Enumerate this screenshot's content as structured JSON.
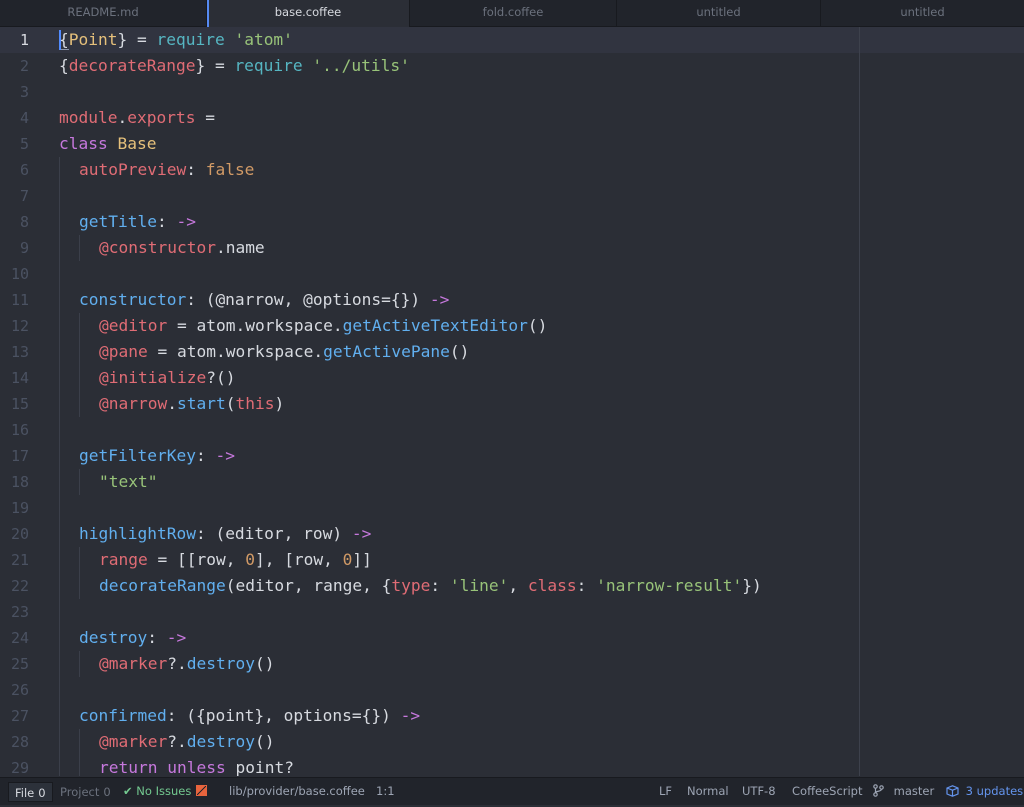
{
  "tabs": [
    {
      "label": "README.md",
      "active": false
    },
    {
      "label": "base.coffee",
      "active": true
    },
    {
      "label": "fold.coffee",
      "active": false
    },
    {
      "label": "untitled",
      "active": false
    },
    {
      "label": "untitled",
      "active": false
    }
  ],
  "editor": {
    "cursor_line": 1,
    "lines": [
      {
        "n": "1",
        "indent": 0,
        "tokens": [
          [
            "p",
            "{"
          ],
          [
            "c",
            "Point"
          ],
          [
            "p",
            "} = "
          ],
          [
            "r",
            "require"
          ],
          [
            "p",
            " "
          ],
          [
            "s",
            "'atom'"
          ]
        ]
      },
      {
        "n": "2",
        "indent": 0,
        "tokens": [
          [
            "p",
            "{"
          ],
          [
            "v",
            "decorateRange"
          ],
          [
            "p",
            "} = "
          ],
          [
            "r",
            "require"
          ],
          [
            "p",
            " "
          ],
          [
            "s",
            "'../utils'"
          ]
        ]
      },
      {
        "n": "3",
        "indent": 0,
        "tokens": []
      },
      {
        "n": "4",
        "indent": 0,
        "tokens": [
          [
            "v",
            "module"
          ],
          [
            "p",
            "."
          ],
          [
            "v",
            "exports"
          ],
          [
            "p",
            " ="
          ]
        ]
      },
      {
        "n": "5",
        "indent": 0,
        "tokens": [
          [
            "k",
            "class"
          ],
          [
            "p",
            " "
          ],
          [
            "c",
            "Base"
          ]
        ]
      },
      {
        "n": "6",
        "indent": 1,
        "tokens": [
          [
            "v",
            "autoPreview"
          ],
          [
            "p",
            ": "
          ],
          [
            "n",
            "false"
          ]
        ]
      },
      {
        "n": "7",
        "indent": 1,
        "tokens": []
      },
      {
        "n": "8",
        "indent": 1,
        "tokens": [
          [
            "f",
            "getTitle"
          ],
          [
            "p",
            ": "
          ],
          [
            "k",
            "->"
          ]
        ]
      },
      {
        "n": "9",
        "indent": 2,
        "tokens": [
          [
            "v",
            "@constructor"
          ],
          [
            "p",
            ".name"
          ]
        ]
      },
      {
        "n": "10",
        "indent": 1,
        "tokens": []
      },
      {
        "n": "11",
        "indent": 1,
        "tokens": [
          [
            "f",
            "constructor"
          ],
          [
            "p",
            ": (@narrow, @options={}) "
          ],
          [
            "k",
            "->"
          ]
        ]
      },
      {
        "n": "12",
        "indent": 2,
        "tokens": [
          [
            "v",
            "@editor"
          ],
          [
            "p",
            " = atom.workspace."
          ],
          [
            "f",
            "getActiveTextEditor"
          ],
          [
            "p",
            "()"
          ]
        ]
      },
      {
        "n": "13",
        "indent": 2,
        "tokens": [
          [
            "v",
            "@pane"
          ],
          [
            "p",
            " = atom.workspace."
          ],
          [
            "f",
            "getActivePane"
          ],
          [
            "p",
            "()"
          ]
        ]
      },
      {
        "n": "14",
        "indent": 2,
        "tokens": [
          [
            "v",
            "@initialize"
          ],
          [
            "p",
            "?()"
          ]
        ]
      },
      {
        "n": "15",
        "indent": 2,
        "tokens": [
          [
            "v",
            "@narrow"
          ],
          [
            "p",
            "."
          ],
          [
            "f",
            "start"
          ],
          [
            "p",
            "("
          ],
          [
            "v",
            "this"
          ],
          [
            "p",
            ")"
          ]
        ]
      },
      {
        "n": "16",
        "indent": 1,
        "tokens": []
      },
      {
        "n": "17",
        "indent": 1,
        "tokens": [
          [
            "f",
            "getFilterKey"
          ],
          [
            "p",
            ": "
          ],
          [
            "k",
            "->"
          ]
        ]
      },
      {
        "n": "18",
        "indent": 2,
        "tokens": [
          [
            "s",
            "\"text\""
          ]
        ]
      },
      {
        "n": "19",
        "indent": 1,
        "tokens": []
      },
      {
        "n": "20",
        "indent": 1,
        "tokens": [
          [
            "f",
            "highlightRow"
          ],
          [
            "p",
            ": (editor, row) "
          ],
          [
            "k",
            "->"
          ]
        ]
      },
      {
        "n": "21",
        "indent": 2,
        "tokens": [
          [
            "v",
            "range"
          ],
          [
            "p",
            " = [[row, "
          ],
          [
            "n",
            "0"
          ],
          [
            "p",
            "], [row, "
          ],
          [
            "n",
            "0"
          ],
          [
            "p",
            "]]"
          ]
        ]
      },
      {
        "n": "22",
        "indent": 2,
        "tokens": [
          [
            "f",
            "decorateRange"
          ],
          [
            "p",
            "(editor, range, {"
          ],
          [
            "v",
            "type"
          ],
          [
            "p",
            ": "
          ],
          [
            "s",
            "'line'"
          ],
          [
            "p",
            ", "
          ],
          [
            "v",
            "class"
          ],
          [
            "p",
            ": "
          ],
          [
            "s",
            "'narrow-result'"
          ],
          [
            "p",
            "})"
          ]
        ]
      },
      {
        "n": "23",
        "indent": 1,
        "tokens": []
      },
      {
        "n": "24",
        "indent": 1,
        "tokens": [
          [
            "f",
            "destroy"
          ],
          [
            "p",
            ": "
          ],
          [
            "k",
            "->"
          ]
        ]
      },
      {
        "n": "25",
        "indent": 2,
        "tokens": [
          [
            "v",
            "@marker"
          ],
          [
            "p",
            "?."
          ],
          [
            "f",
            "destroy"
          ],
          [
            "p",
            "()"
          ]
        ]
      },
      {
        "n": "26",
        "indent": 1,
        "tokens": []
      },
      {
        "n": "27",
        "indent": 1,
        "tokens": [
          [
            "f",
            "confirmed"
          ],
          [
            "p",
            ": ({point}, options={}) "
          ],
          [
            "k",
            "->"
          ]
        ]
      },
      {
        "n": "28",
        "indent": 2,
        "tokens": [
          [
            "v",
            "@marker"
          ],
          [
            "p",
            "?."
          ],
          [
            "f",
            "destroy"
          ],
          [
            "p",
            "()"
          ]
        ]
      },
      {
        "n": "29",
        "indent": 2,
        "tokens": [
          [
            "k",
            "return"
          ],
          [
            "p",
            " "
          ],
          [
            "k",
            "unless"
          ],
          [
            "p",
            " point?"
          ]
        ]
      }
    ]
  },
  "statusbar": {
    "file_tab": {
      "label": "File",
      "count": "0"
    },
    "project_tab": {
      "label": "Project",
      "count": "0"
    },
    "linter": {
      "label": "No Issues",
      "icon": "check-icon"
    },
    "path": "lib/provider/base.coffee",
    "position": "1:1",
    "line_ending": "LF",
    "mode": "Normal",
    "encoding": "UTF-8",
    "grammar": "CoffeeScript",
    "branch": "master",
    "updates": "3 updates"
  },
  "colors": {
    "accent": "#568af2",
    "keyword": "#c678dd",
    "string": "#98c379",
    "variable": "#e06c75",
    "function": "#61afef",
    "class": "#e5c07b",
    "number": "#d19a66",
    "builtin": "#56b6c2"
  }
}
